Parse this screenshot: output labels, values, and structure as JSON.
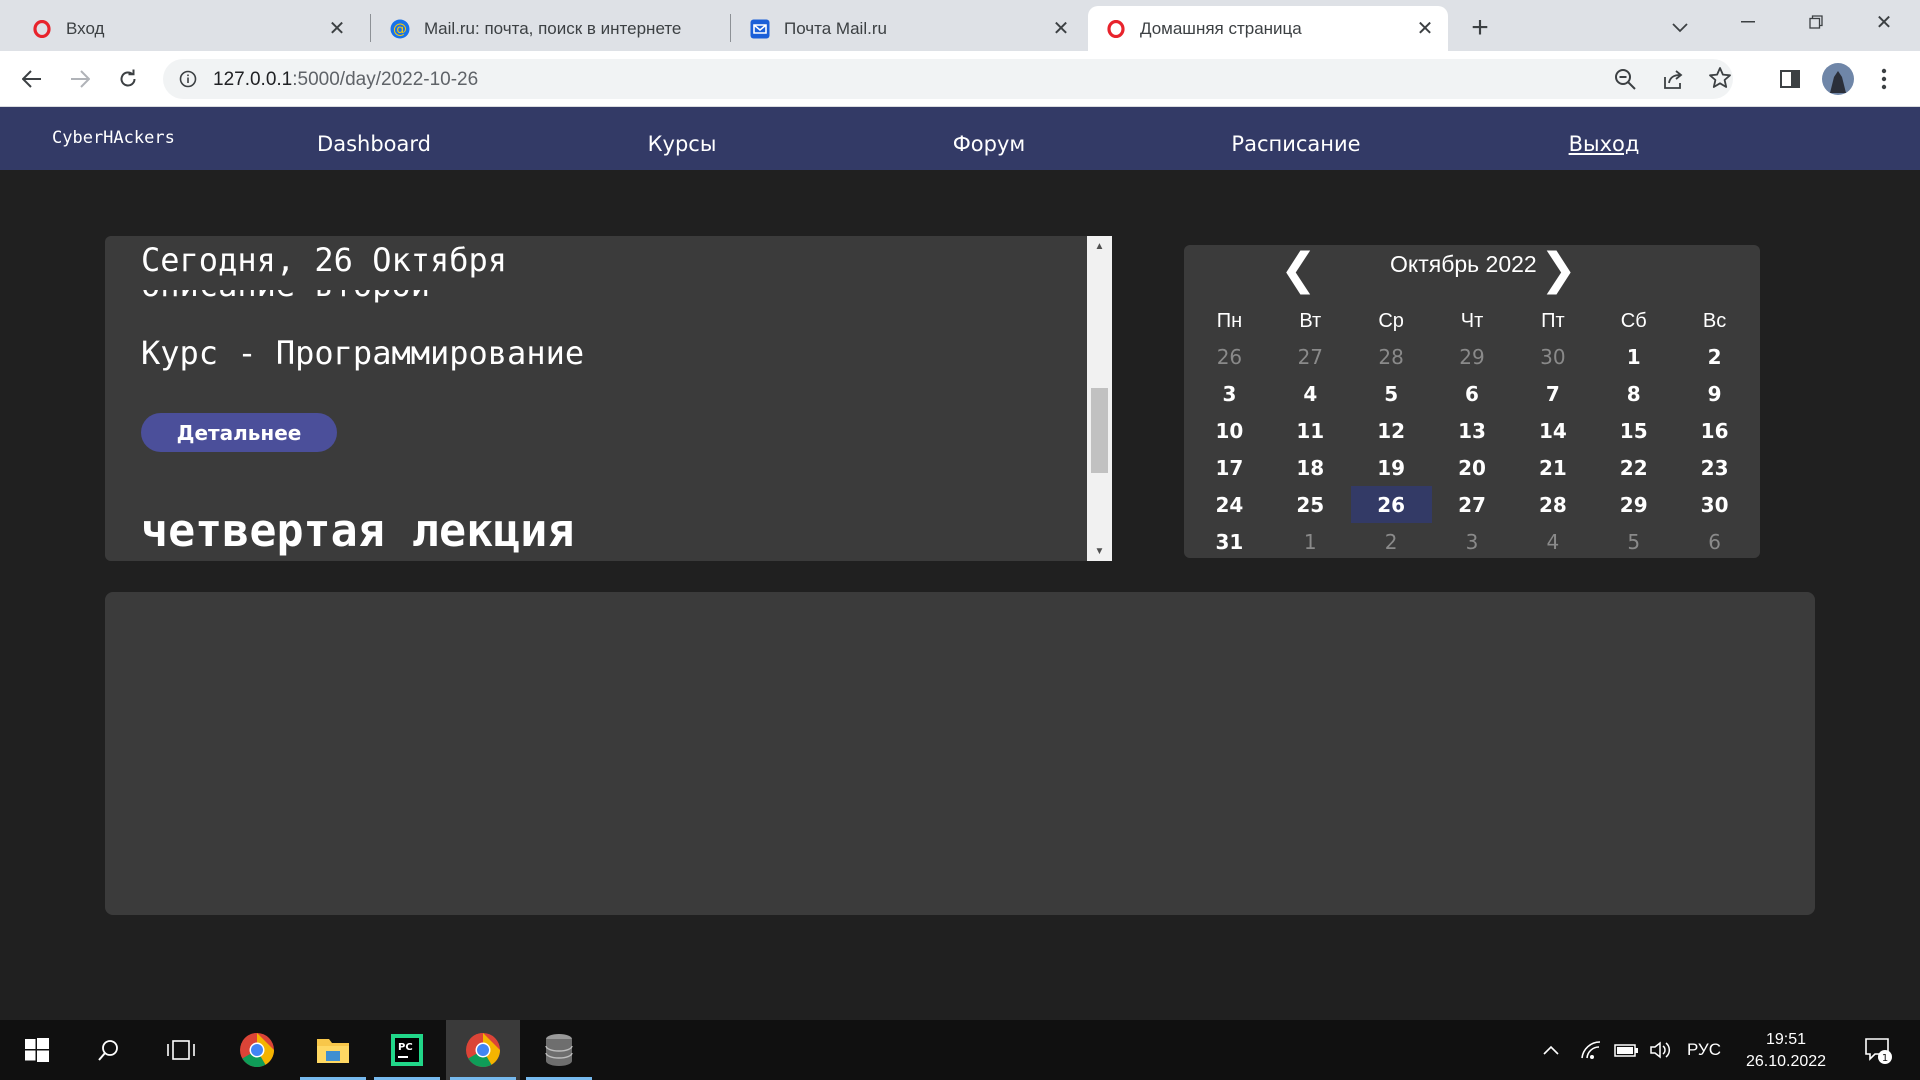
{
  "browser": {
    "tabs": [
      {
        "title": "Вход",
        "icon": "opera-icon"
      },
      {
        "title": "Mail.ru: почта, поиск в интернете",
        "icon": "mailru-at-icon"
      },
      {
        "title": "Почта Mail.ru",
        "icon": "mail-envelope-icon"
      },
      {
        "title": "Домашняя страница",
        "icon": "opera-icon",
        "active": true
      }
    ],
    "url_host": "127.0.0.1",
    "url_rest": ":5000/day/2022-10-26"
  },
  "site": {
    "brand": "CyberHAckers",
    "nav": [
      "Dashboard",
      "Курсы",
      "Форум",
      "Расписание",
      "Выход"
    ]
  },
  "lectures": {
    "today": "Сегодня, 26 Октября",
    "description": "описание второй",
    "course": "Курс - Программирование",
    "details_button": "Детальнее",
    "next_lecture_title": "четвертая лекция"
  },
  "calendar": {
    "title": "Октябрь 2022",
    "prev": "❮",
    "next": "❯",
    "weekdays": [
      "Пн",
      "Вт",
      "Ср",
      "Чт",
      "Пт",
      "Сб",
      "Вс"
    ],
    "weeks": [
      [
        "26",
        "27",
        "28",
        "29",
        "30",
        "1",
        "2"
      ],
      [
        "3",
        "4",
        "5",
        "6",
        "7",
        "8",
        "9"
      ],
      [
        "10",
        "11",
        "12",
        "13",
        "14",
        "15",
        "16"
      ],
      [
        "17",
        "18",
        "19",
        "20",
        "21",
        "22",
        "23"
      ],
      [
        "24",
        "25",
        "26",
        "27",
        "28",
        "29",
        "30"
      ],
      [
        "31",
        "1",
        "2",
        "3",
        "4",
        "5",
        "6"
      ]
    ],
    "selected_day": "26"
  },
  "taskbar": {
    "language": "РУС",
    "time": "19:51",
    "date": "26.10.2022",
    "notifications": "1"
  },
  "colors": {
    "nav_bg": "#333a66",
    "panel_bg": "#3b3b3b",
    "page_bg": "#202020",
    "button_bg": "#4b4f9a"
  }
}
